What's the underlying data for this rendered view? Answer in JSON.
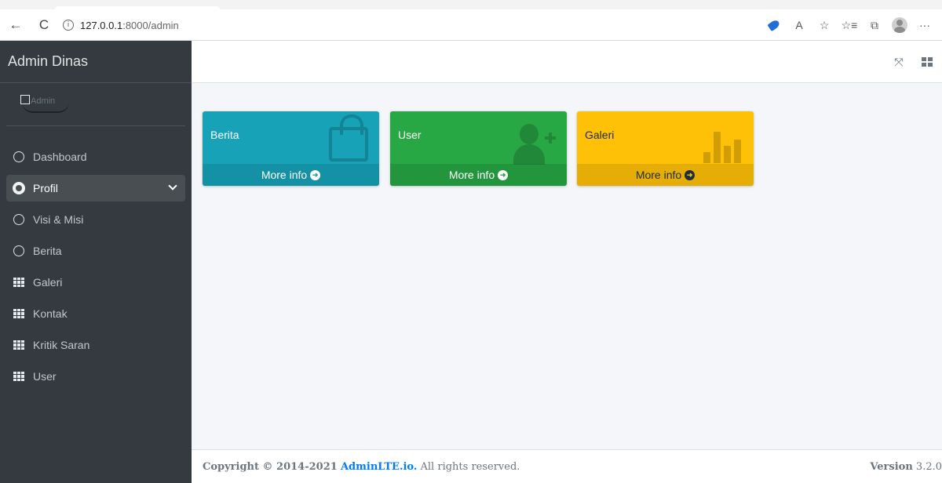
{
  "browser": {
    "url_host": "127.0.0.1",
    "url_path": ":8000/admin",
    "back_glyph": "←",
    "reload_glyph": "C",
    "info_glyph": "i",
    "read_glyph": "A",
    "fav_glyph": "☆",
    "favlist_glyph": "☆≡",
    "collections_glyph": "⧉",
    "more_glyph": "···"
  },
  "sidebar": {
    "brand": "Admin Dinas",
    "avatar_text": "Admin",
    "items": [
      {
        "label": "Dashboard",
        "icon": "circle-icon"
      },
      {
        "label": "Profil",
        "icon": "tachometer-icon"
      },
      {
        "label": "Visi & Misi",
        "icon": "circle-icon"
      },
      {
        "label": "Berita",
        "icon": "circle-icon"
      },
      {
        "label": "Galeri",
        "icon": "th-icon"
      },
      {
        "label": "Kontak",
        "icon": "th-icon"
      },
      {
        "label": "Kritik Saran",
        "icon": "th-icon"
      },
      {
        "label": "User",
        "icon": "th-icon"
      }
    ]
  },
  "topnav": {
    "expand_glyph": "⤧"
  },
  "boxes": [
    {
      "title": "Berita",
      "link": "More info",
      "color": "#17a2b8",
      "icon": "shopping-bag-icon"
    },
    {
      "title": "User",
      "link": "More info",
      "color": "#28a745",
      "icon": "user-plus-icon"
    },
    {
      "title": "Galeri",
      "link": "More info",
      "color": "#ffc107",
      "icon": "bar-chart-icon"
    }
  ],
  "footer": {
    "copyright": "Copyright © 2014-2021",
    "brand_link": "AdminLTE.io.",
    "rights": "All rights reserved.",
    "version_label": "Version",
    "version_value": "3.2.0"
  },
  "colors": {
    "sidebar_bg": "#343a40",
    "active_item_bg": "#494e53",
    "content_bg": "#f4f6f9",
    "link": "#007bff"
  }
}
